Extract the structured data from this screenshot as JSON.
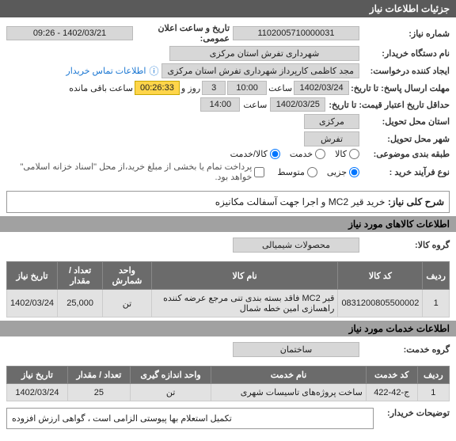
{
  "header": {
    "title": "جزئیات اطلاعات نیاز"
  },
  "fields": {
    "need_no_label": "شماره نیاز:",
    "need_no": "1102005710000031",
    "announce_label": "تاریخ و ساعت اعلان عمومی:",
    "announce_value": "1402/03/21 - 09:26",
    "buyer_label": "نام دستگاه خریدار:",
    "buyer_value": "شهرداری تفرش استان مرکزی",
    "requester_label": "ایجاد کننده درخواست:",
    "requester_value": "مجد کاظمی کارپرداز شهرداری تفرش استان مرکزی",
    "contact_link": "اطلاعات تماس خریدار",
    "reply_deadline_label": "مهلت ارسال پاسخ: تا تاریخ:",
    "reply_date": "1402/03/24",
    "saat_label": "ساعت",
    "reply_time": "10:00",
    "days_label": "روز و",
    "days_value": "3",
    "timer": "00:26:33",
    "remaining_label": "ساعت باقی مانده",
    "validity_label": "حداقل تاریخ اعتبار قیمت: تا تاریخ:",
    "validity_date": "1402/03/25",
    "validity_time": "14:00",
    "delivery_province_label": "استان محل تحویل:",
    "delivery_province": "مرکزی",
    "delivery_city_label": "شهر محل تحویل:",
    "delivery_city": "تفرش",
    "category_label": "طبقه بندی موضوعی:",
    "cat_goods": "کالا",
    "cat_service": "خدمت",
    "cat_both": "کالا/خدمت",
    "process_label": "نوع فرآیند خرید :",
    "proc_minor": "جزیی",
    "proc_medium": "متوسط",
    "payment_note": "پرداخت تمام یا بخشی از مبلغ خرید،از محل \"اسناد خزانه اسلامی\" خواهد بود."
  },
  "summary": {
    "label": "شرح کلی نیاز:",
    "text": "خرید قیر MC2 و اجرا جهت آسفالت مکانیزه"
  },
  "goods": {
    "section_title": "اطلاعات کالاهای مورد نیاز",
    "group_label": "گروه کالا:",
    "group_value": "محصولات شیمیالی",
    "headers": {
      "row": "ردیف",
      "code": "کد کالا",
      "name": "نام کالا",
      "unit": "واحد شمارش",
      "qty": "تعداد / مقدار",
      "date": "تاریخ نیاز"
    },
    "rows": [
      {
        "idx": "1",
        "code": "0831200805500002",
        "name": "قیر MC2 فاقد بسته بندی تنی مرجع عرضه کننده راهسازی امین خطه شمال",
        "unit": "تن",
        "qty": "25,000",
        "date": "1402/03/24"
      }
    ]
  },
  "services": {
    "section_title": "اطلاعات خدمات مورد نیاز",
    "group_label": "گروه خدمت:",
    "group_value": "ساختمان",
    "headers": {
      "row": "ردیف",
      "code": "کد خدمت",
      "name": "نام خدمت",
      "unit": "واحد اندازه گیری",
      "qty": "تعداد / مقدار",
      "date": "تاریخ نیاز"
    },
    "rows": [
      {
        "idx": "1",
        "code": "ج-42-422",
        "name": "ساخت پروژه‌های تاسیسات شهری",
        "unit": "تن",
        "qty": "25",
        "date": "1402/03/24"
      }
    ]
  },
  "footer": {
    "label": "توضیحات خریدار:",
    "text": "تکمیل استعلام بها پیوستی الزامی است ، گواهی ارزش افزوده"
  }
}
